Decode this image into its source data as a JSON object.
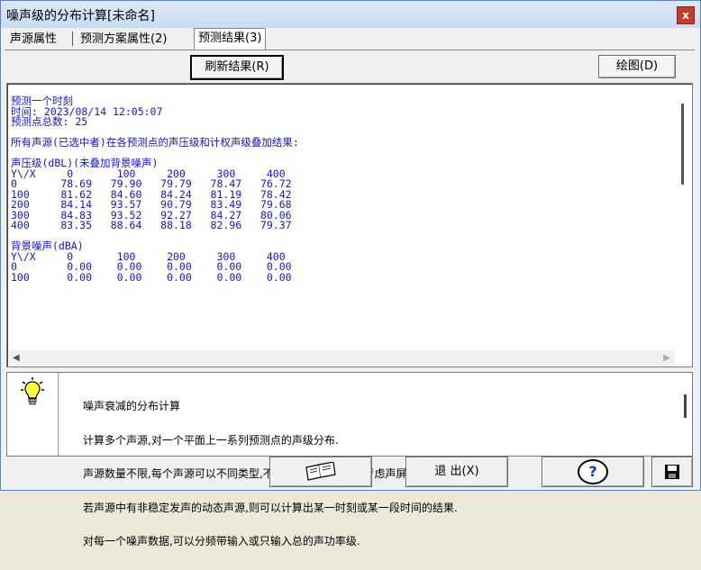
{
  "window": {
    "title": "噪声级的分布计算[未命名]",
    "close_label": "x"
  },
  "tabs": [
    {
      "label": "声源属性"
    },
    {
      "label": "预测方案属性(2)"
    },
    {
      "label": "预测结果(3)"
    }
  ],
  "toolbar": {
    "refresh_label": "刷新结果(R)",
    "draw_label": "绘图(D)"
  },
  "output": {
    "text": "预测一个时刻\n时间: 2023/08/14 12:05:07\n预测点总数: 25\n\n所有声源(已选中者)在各预测点的声压级和计权声级叠加结果:\n\n声压级(dBL)(未叠加背景噪声)\nY\\/X     0       100     200     300     400\n0       78.69   79.90   79.79   78.47   76.72\n100     81.62   84.60   84.24   81.19   78.42\n200     84.14   93.57   90.79   83.49   79.68\n300     84.83   93.52   92.27   84.27   80.06\n400     83.35   88.64   88.18   82.96   79.37\n\n背景噪声(dBA)\nY\\/X     0       100     200     300     400\n0        0.00    0.00    0.00    0.00    0.00\n100      0.00    0.00    0.00    0.00    0.00"
  },
  "info": {
    "lines": [
      "噪声衰减的分布计算",
      "计算多个声源,对一个平面上一系列预测点的声级分布.",
      "声源数量不限,每个声源可以不同类型,不同发声特性,但不能考虑声屏和隔墙.",
      "若声源中有非稳定发声的动态声源,则可以计算出某一时刻或某一段时间的结果.",
      "对每一个噪声数据,可以分频带输入或只输入总的声功率级."
    ]
  },
  "buttons": {
    "exit_label": "退 出(X)",
    "help_label": "?"
  },
  "colors": {
    "output_text": "#1515d0",
    "title_bar": "#c9dcf2",
    "close_button": "#c43c2c"
  },
  "icons": [
    "lightbulb-icon",
    "book-icon",
    "help-icon",
    "save-disk-icon",
    "close-icon"
  ]
}
